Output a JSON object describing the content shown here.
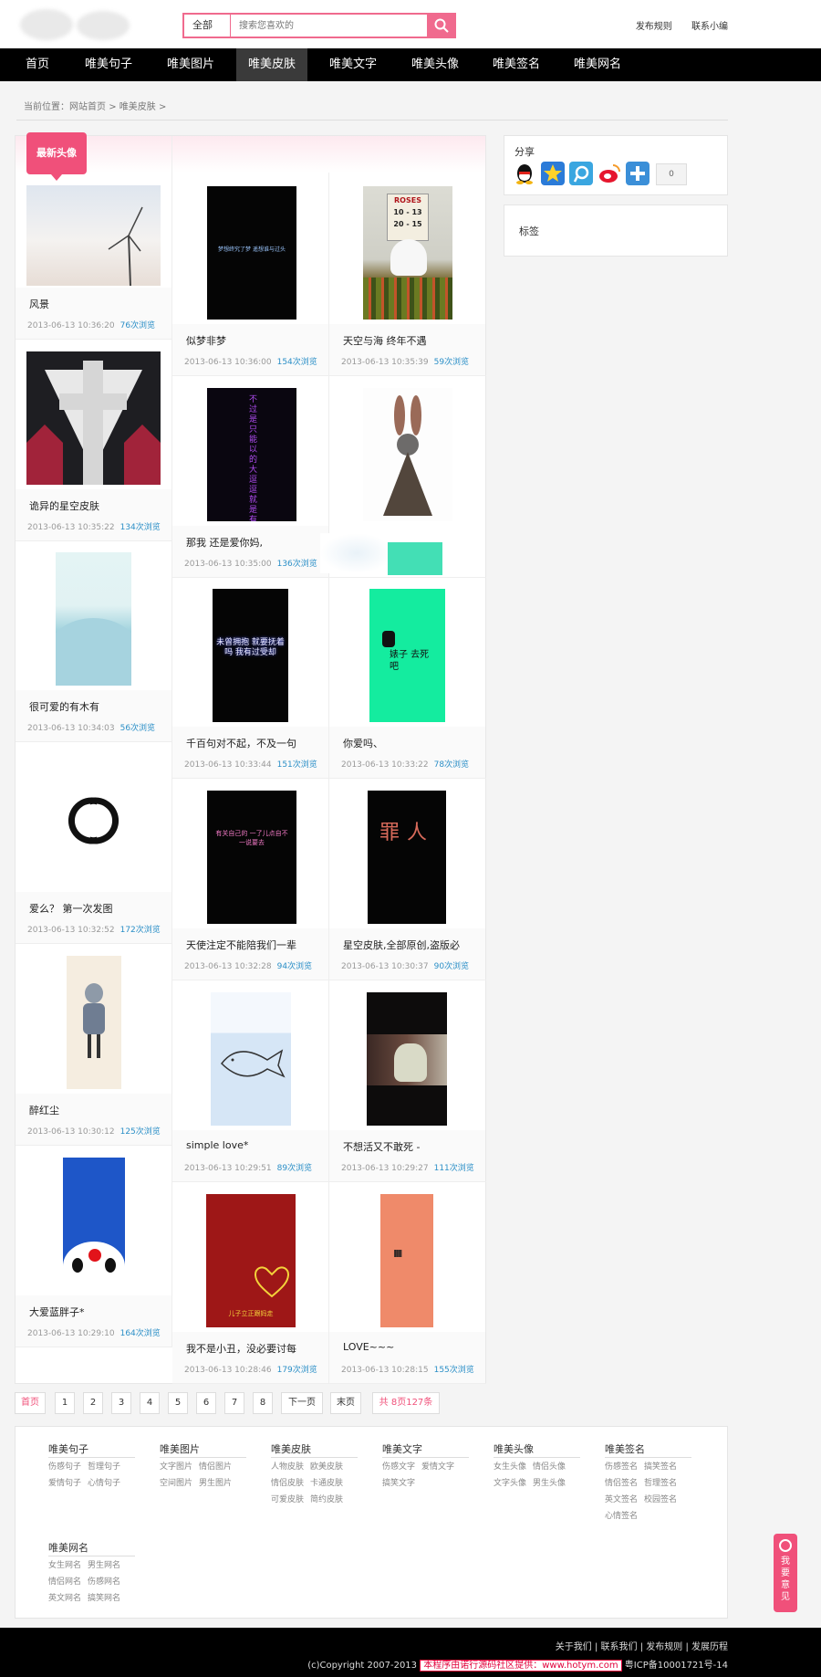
{
  "search": {
    "category": "全部",
    "placeholder": "搜索您喜欢的"
  },
  "toplinks": [
    "发布规则",
    "联系小编"
  ],
  "nav": [
    "首页",
    "唯美句子",
    "唯美图片",
    "唯美皮肤",
    "唯美文字",
    "唯美头像",
    "唯美签名",
    "唯美网名"
  ],
  "nav_active": "唯美皮肤",
  "breadcrumb": {
    "label": "当前位置：",
    "home": "网站首页",
    "sep": ">",
    "current": "唯美皮肤",
    "sep2": ">"
  },
  "section_tag": "最新头像",
  "cards": [
    {
      "title": "风景",
      "date": "2013-06-13 10:36:20",
      "views": "76次浏览"
    },
    {
      "title": "似梦非梦",
      "date": "2013-06-13 10:36:00",
      "views": "154次浏览"
    },
    {
      "title": "天空与海 终年不遇",
      "date": "2013-06-13 10:35:39",
      "views": "59次浏览"
    },
    {
      "title": "诡异的星空皮肤",
      "date": "2013-06-13 10:35:22",
      "views": "134次浏览"
    },
    {
      "title": "那我 还是爱你妈,",
      "date": "2013-06-13 10:35:00",
      "views": "136次浏览"
    },
    {
      "title": "",
      "date": "",
      "views": ""
    },
    {
      "title": "很可爱的有木有",
      "date": "2013-06-13 10:34:03",
      "views": "56次浏览"
    },
    {
      "title": "千百句对不起，不及一句",
      "date": "2013-06-13 10:33:44",
      "views": "151次浏览"
    },
    {
      "title": "你爱吗、",
      "date": "2013-06-13 10:33:22",
      "views": "78次浏览"
    },
    {
      "title": "爱么？ 第一次发图",
      "date": "2013-06-13 10:32:52",
      "views": "172次浏览"
    },
    {
      "title": "天使注定不能陪我们一辈",
      "date": "2013-06-13 10:32:28",
      "views": "94次浏览"
    },
    {
      "title": "星空皮肤,全部原创,盗版必",
      "date": "2013-06-13 10:30:37",
      "views": "90次浏览"
    },
    {
      "title": "醉红尘",
      "date": "2013-06-13 10:30:12",
      "views": "125次浏览"
    },
    {
      "title": "simple love*",
      "date": "2013-06-13 10:29:51",
      "views": "89次浏览"
    },
    {
      "title": "不想活又不敢死 -",
      "date": "2013-06-13 10:29:27",
      "views": "111次浏览"
    },
    {
      "title": "大爱蓝胖子*",
      "date": "2013-06-13 10:29:10",
      "views": "164次浏览"
    },
    {
      "title": "我不是小丑，没必要讨每",
      "date": "2013-06-13 10:28:46",
      "views": "179次浏览"
    },
    {
      "title": "LOVE~~~",
      "date": "2013-06-13 10:28:15",
      "views": "155次浏览"
    }
  ],
  "thumb_text": {
    "t1": "梦想终究了梦 遥想谁与过头",
    "t2_sign": "ROSES",
    "t2_sign2": "10 - 13",
    "t2_sign3": "20 - 15",
    "t5": "不过是只能以的大逗逗 就是有心所思都够的",
    "t8": "未曾拥抱 就要抚着吗 我有过受却",
    "t9": "婊子 去死吧",
    "t11": "有关自己的 一了儿点自不一说要去",
    "t12": "罪人",
    "t17": "儿子立正跟妈走",
    "t18": "||||||||||||"
  },
  "sidebar": {
    "share_title": "分享",
    "share_count": "0",
    "tags_title": "标签"
  },
  "pager": [
    "首页",
    "1",
    "2",
    "3",
    "4",
    "5",
    "6",
    "7",
    "8",
    "下一页",
    "末页",
    "共 8页127条"
  ],
  "footer_cols": [
    {
      "title": "唯美句子",
      "links": [
        "伤感句子",
        "哲理句子",
        "爱情句子",
        "心情句子"
      ]
    },
    {
      "title": "唯美图片",
      "links": [
        "文字图片",
        "情侣图片",
        "空间图片",
        "男生图片"
      ]
    },
    {
      "title": "唯美皮肤",
      "links": [
        "人物皮肤",
        "欧美皮肤",
        "情侣皮肤",
        "卡通皮肤",
        "可爱皮肤",
        "简约皮肤"
      ]
    },
    {
      "title": "唯美文字",
      "links": [
        "伤感文字",
        "爱情文字",
        "搞笑文字"
      ]
    },
    {
      "title": "唯美头像",
      "links": [
        "女生头像",
        "情侣头像",
        "文字头像",
        "男生头像"
      ]
    },
    {
      "title": "唯美签名",
      "links": [
        "伤感签名",
        "搞笑签名",
        "情侣签名",
        "哲理签名",
        "英文签名",
        "校园签名",
        "心情签名"
      ]
    },
    {
      "title": "唯美网名",
      "links": [
        "女生网名",
        "男生网名",
        "情侣网名",
        "伤感网名",
        "英文网名",
        "搞笑网名"
      ]
    }
  ],
  "feedback": "我要意见",
  "bottom": {
    "links": [
      "关于我们",
      "联系我们",
      "发布规则",
      "发展历程"
    ],
    "copyright": "(c)Copyright 2007-2013",
    "powered": "本程序由诺行源码社区提供：www.hotym.com",
    "icp": "粤ICP备10001721号-14"
  },
  "colors": {
    "accent": "#f06a8e",
    "nav_bg": "#000000",
    "view_link": "#2b8fc7"
  }
}
